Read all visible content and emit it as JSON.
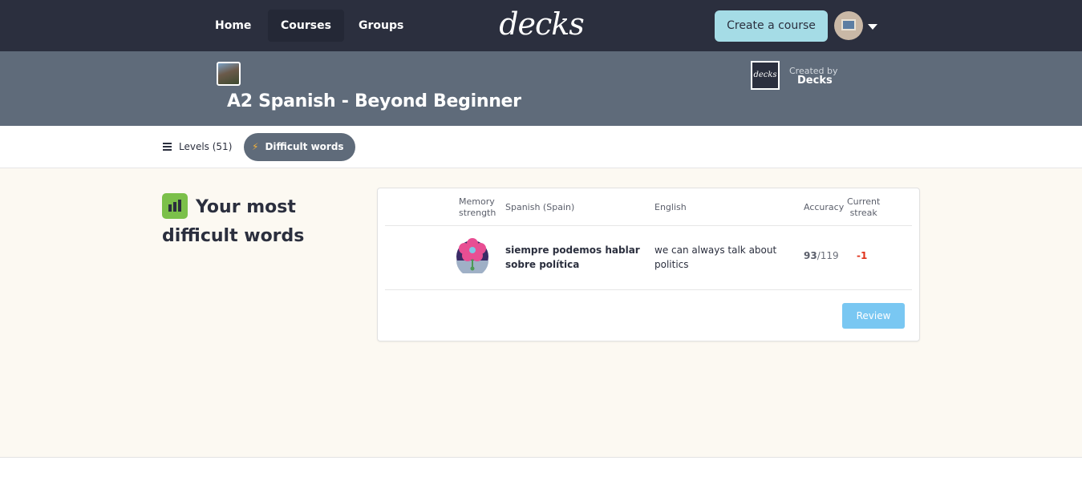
{
  "topnav": {
    "links": [
      "Home",
      "Courses",
      "Groups"
    ],
    "logo_text": "decks",
    "create_label": "Create a course"
  },
  "course": {
    "title": "A2 Spanish - Beyond Beginner",
    "creator_logo_text": "decks",
    "created_by_label": "Created by",
    "creator_name": "Decks"
  },
  "tabs": {
    "levels_label": "Levels (51)",
    "difficult_label": "Difficult words"
  },
  "difficult": {
    "title": "Your most difficult words",
    "headers": {
      "memory_1": "Memory",
      "memory_2": "strength",
      "spanish": "Spanish (Spain)",
      "english": "English",
      "accuracy": "Accuracy",
      "streak_1": "Current",
      "streak_2": "streak"
    },
    "words": [
      {
        "spanish": "siempre podemos hablar sobre política",
        "english": "we can always talk about politics",
        "accuracy_correct": "93",
        "accuracy_total": "/119",
        "streak": "-1"
      }
    ],
    "review_label": "Review"
  },
  "colors": {
    "nav_bg": "#2b2f3e",
    "course_band": "#5f6b7a",
    "create_btn": "#a5dce6",
    "main_bg": "#fcf9f2",
    "accent_green": "#7bc04a",
    "review_btn": "#79c7f2",
    "streak_negative": "#e0321b"
  },
  "icons": [
    "list-icon",
    "bolt-icon",
    "bar-chart-icon",
    "flower-memory-icon",
    "chevron-down-icon"
  ]
}
